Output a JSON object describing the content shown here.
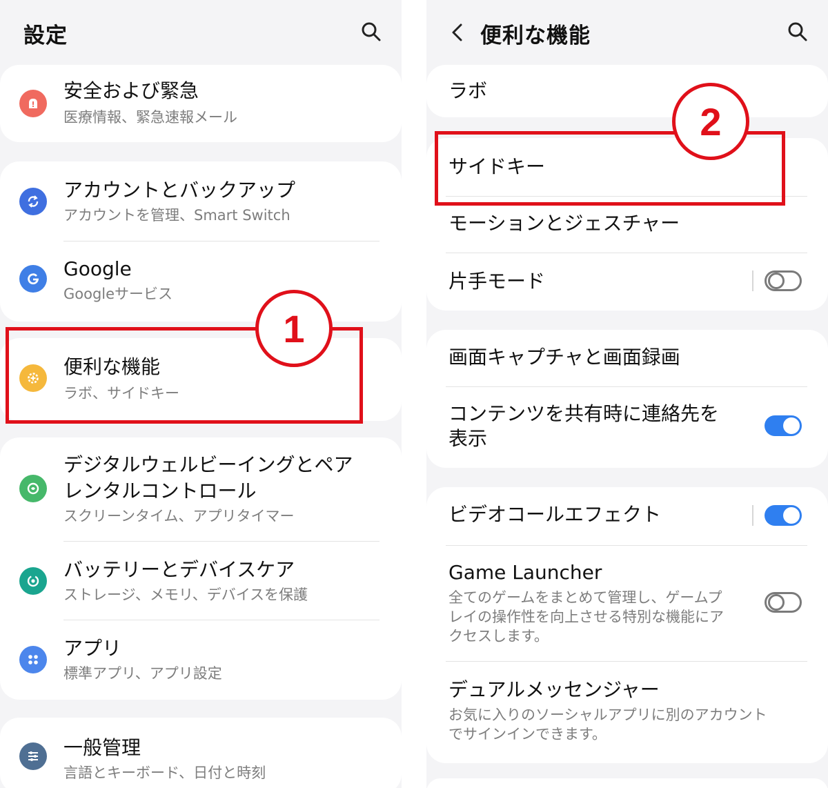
{
  "left": {
    "title": "設定",
    "items": [
      {
        "title": "安全および緊急",
        "subtitle": "医療情報、緊急速報メール",
        "icon": "alert-icon",
        "color": "#f06a5f"
      },
      {
        "title": "アカウントとバックアップ",
        "subtitle": "アカウントを管理、Smart Switch",
        "icon": "sync-icon",
        "color": "#3f6fe0"
      },
      {
        "title": "Google",
        "subtitle": "Googleサービス",
        "icon": "google-icon",
        "color": "#3f7fe6"
      },
      {
        "title": "便利な機能",
        "subtitle": "ラボ、サイドキー",
        "icon": "gear-plus-icon",
        "color": "#f5b83c"
      },
      {
        "title": "デジタルウェルビーイングとペア",
        "title2": "レンタルコントロール",
        "subtitle": "スクリーンタイム、アプリタイマー",
        "icon": "wellbeing-icon",
        "color": "#46b86a"
      },
      {
        "title": "バッテリーとデバイスケア",
        "subtitle": "ストレージ、メモリ、デバイスを保護",
        "icon": "device-care-icon",
        "color": "#1aa58f"
      },
      {
        "title": "アプリ",
        "subtitle": "標準アプリ、アプリ設定",
        "icon": "apps-icon",
        "color": "#4c86ec"
      },
      {
        "title": "一般管理",
        "subtitle": "言語とキーボード、日付と時刻",
        "icon": "sliders-icon",
        "color": "#4f6f93"
      }
    ]
  },
  "right": {
    "title": "便利な機能",
    "items": [
      {
        "title": "ラボ"
      },
      {
        "title": "サイドキー"
      },
      {
        "title": "モーションとジェスチャー"
      },
      {
        "title": "片手モード",
        "toggle": false
      },
      {
        "title": "画面キャプチャと画面録画"
      },
      {
        "title": "コンテンツを共有時に連絡先を",
        "title2": "表示",
        "toggle": true
      },
      {
        "title": "ビデオコールエフェクト",
        "toggle": true
      },
      {
        "title": "Game Launcher",
        "subtitle": "全てのゲームをまとめて管理し、ゲームプ",
        "subtitle2": "レイの操作性を向上させる特別な機能にア",
        "subtitle3": "クセスします。",
        "toggle": false
      },
      {
        "title": "デュアルメッセンジャー",
        "subtitle": "お気に入りのソーシャルアプリに別のアカウント",
        "subtitle2": "でサインインできます。"
      }
    ]
  },
  "annotations": {
    "step1": "1",
    "step2": "2",
    "highlight_color": "#e0101a"
  }
}
